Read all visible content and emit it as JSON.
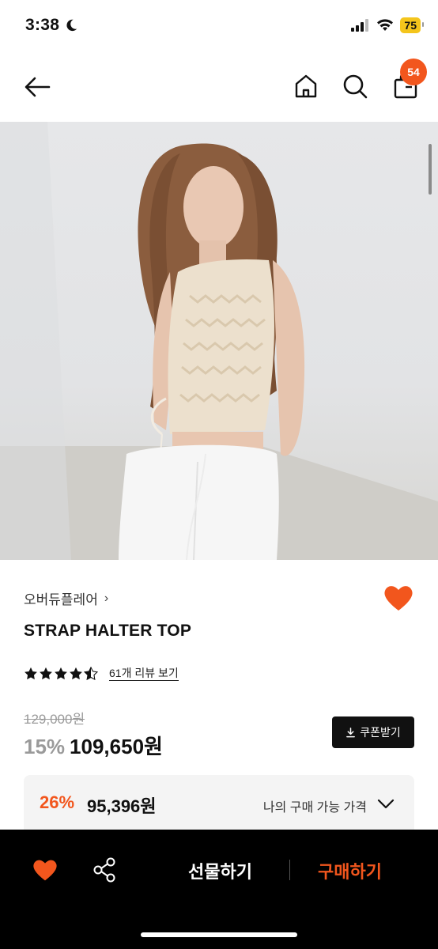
{
  "status_bar": {
    "time": "3:38",
    "battery": "75"
  },
  "header": {
    "cart_count": "54"
  },
  "product": {
    "brand": "오버듀플레어",
    "title": "STRAP HALTER TOP",
    "rating": 4.5,
    "review_link": "61개 리뷰 보기",
    "original_price": "129,000원",
    "discount": "15%",
    "sale_price": "109,650원",
    "coupon_button": "쿠폰받기",
    "my_price": {
      "discount": "26%",
      "price": "95,396원",
      "label": "나의 구매 가능 가격"
    }
  },
  "bottom_bar": {
    "gift_label": "선물하기",
    "buy_label": "구매하기"
  },
  "colors": {
    "accent": "#f2561d",
    "dark": "#000000"
  }
}
